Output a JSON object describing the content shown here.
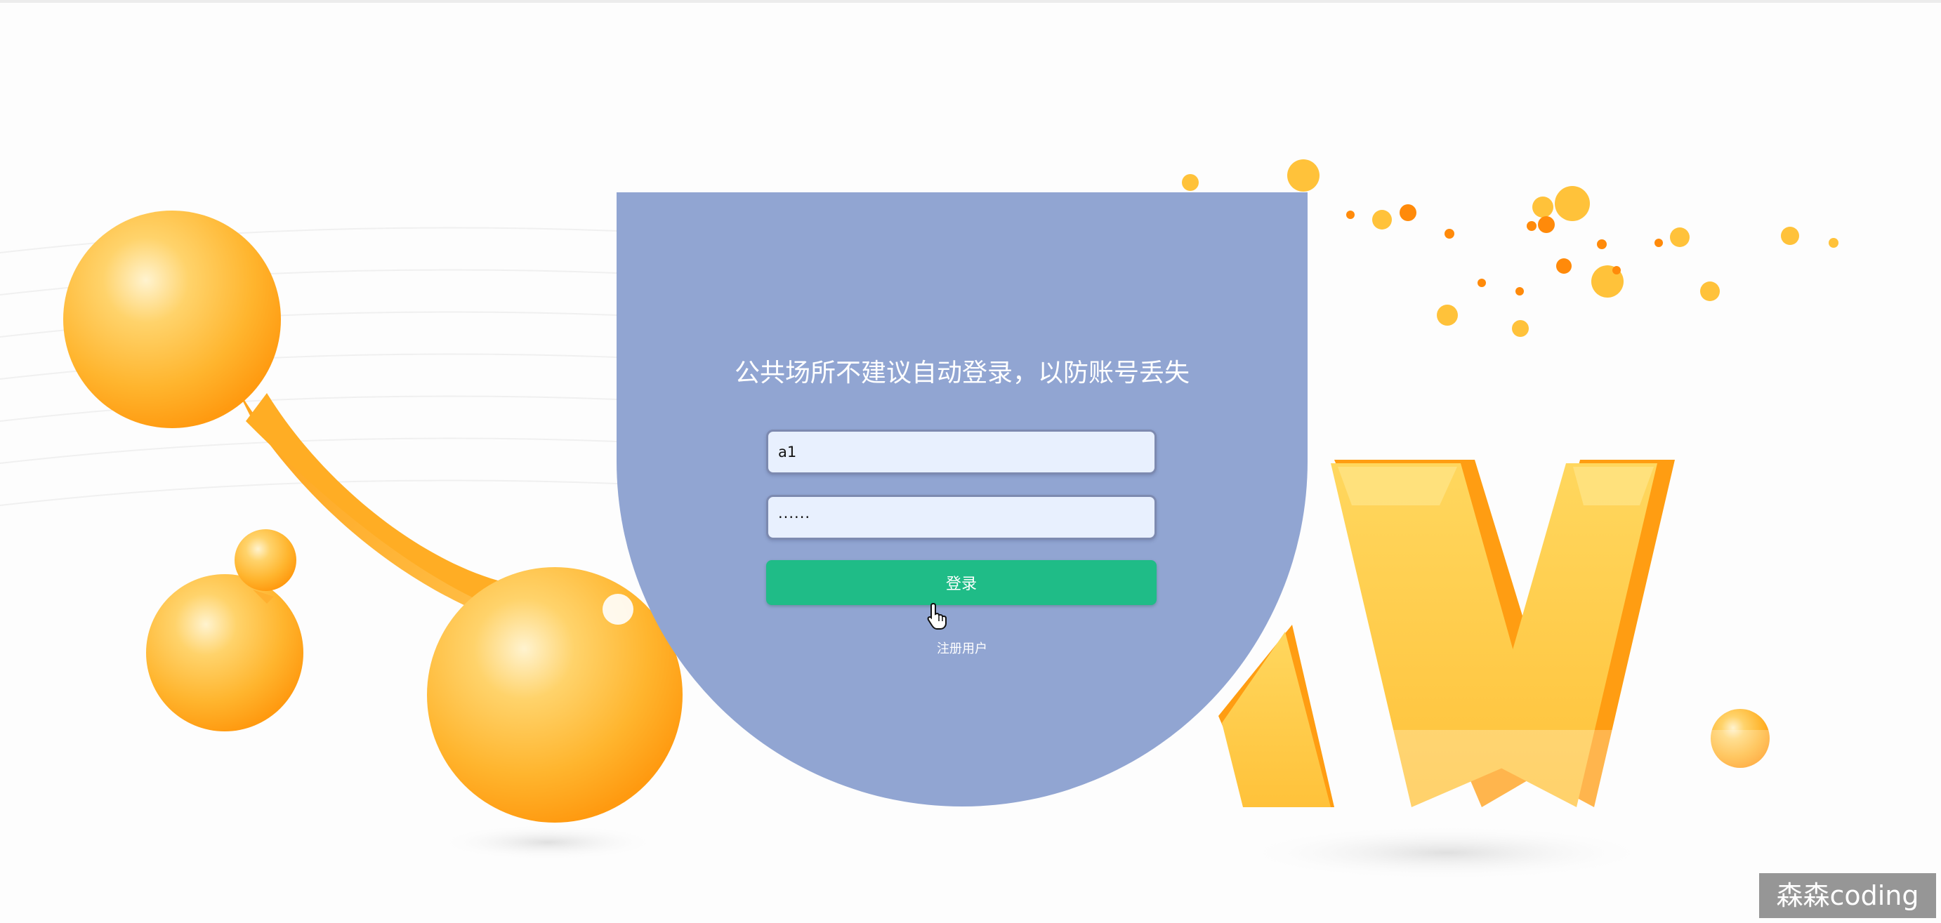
{
  "login": {
    "notice": "公共场所不建议自动登录，以防账号丢失",
    "username_value": "a1",
    "password_value": "······",
    "login_label": "登录",
    "register_label": "注册用户"
  },
  "watermark": {
    "text": "森森coding"
  },
  "colors": {
    "panel": "#91a5d2",
    "login_button": "#1fbc87",
    "input_bg": "#e8f0fe",
    "orange_accent": "#ffb938"
  },
  "icons": {
    "cursor": "hand-pointer-icon"
  }
}
